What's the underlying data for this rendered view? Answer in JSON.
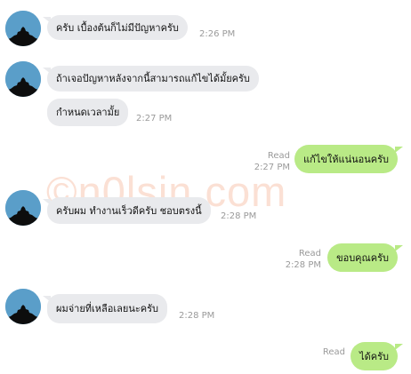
{
  "watermark": "©n0lsin.com",
  "colors": {
    "incoming_bubble": "#e9eaed",
    "outgoing_bubble": "#b9ea86",
    "avatar_bg": "#5a9ec9",
    "meta_text": "#9a9a9a",
    "watermark": "#fbe0d4"
  },
  "messages": [
    {
      "direction": "in",
      "avatar": true,
      "text": "ครับ เบื้องต้นก็ไม่มีปัญหาครับ",
      "time": "2:26 PM"
    },
    {
      "direction": "in",
      "avatar": true,
      "text": "ถ้าเจอปัญหาหลังจากนี้สามารถแก้ไขได้มั้ยครับ",
      "time": ""
    },
    {
      "direction": "in",
      "avatar": false,
      "text": "กำหนดเวลามั้ย",
      "time": "2:27 PM"
    },
    {
      "direction": "out",
      "text": "แก้ไขให้แน่นอนครับ",
      "read": "Read",
      "time": "2:27 PM"
    },
    {
      "direction": "in",
      "avatar": true,
      "text": "ครับผม ทำงานเร็วดีครับ ชอบตรงนี้",
      "time": "2:28 PM"
    },
    {
      "direction": "out",
      "text": "ขอบคุณครับ",
      "read": "Read",
      "time": "2:28 PM"
    },
    {
      "direction": "in",
      "avatar": true,
      "text": "ผมจ่ายที่เหลือเลยนะครับ",
      "time": "2:28 PM"
    },
    {
      "direction": "out",
      "text": "ได้ครับ",
      "read": "Read",
      "time": ""
    }
  ]
}
